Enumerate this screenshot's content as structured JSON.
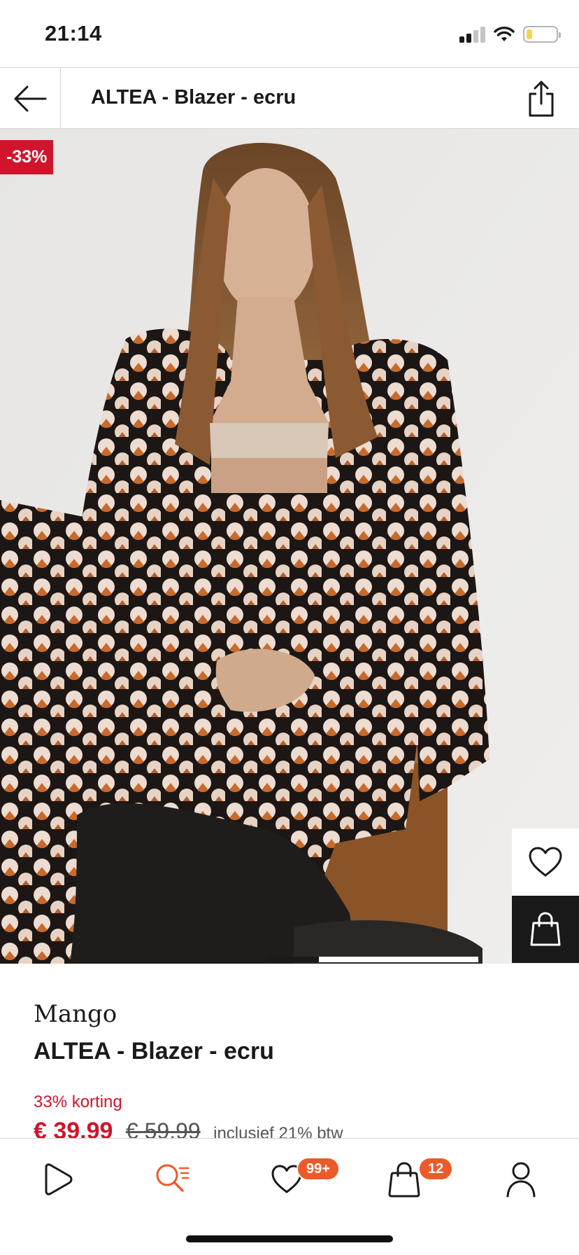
{
  "status_bar": {
    "time": "21:14",
    "icons": [
      "cellular-signal-icon",
      "wifi-icon",
      "battery-icon"
    ],
    "battery_level": 0.2
  },
  "header": {
    "title": "ALTEA - Blazer - ecru",
    "back_icon": "arrow-left-icon",
    "share_icon": "share-icon"
  },
  "hero": {
    "discount_badge": "-33%",
    "wishlist_icon": "heart-icon",
    "bag_icon": "shopping-bag-icon",
    "carousel": {
      "current": 1,
      "total": 4
    }
  },
  "product": {
    "brand": "Mango",
    "title": "ALTEA - Blazer - ecru",
    "discount_text": "33% korting",
    "price_current": "€ 39,99",
    "price_original": "€ 59,99",
    "vat_note": "inclusief 21% btw"
  },
  "tab_bar": {
    "tabs": [
      {
        "name": "home",
        "icon": "play-home-icon"
      },
      {
        "name": "search",
        "icon": "search-list-icon",
        "active": true
      },
      {
        "name": "wishlist",
        "icon": "heart-icon",
        "badge": "99+"
      },
      {
        "name": "bag",
        "icon": "shopping-bag-icon",
        "badge": "12"
      },
      {
        "name": "account",
        "icon": "user-icon"
      }
    ]
  },
  "colors": {
    "accent_orange": "#ec5a2a",
    "sale_red": "#d0142c",
    "text_dark": "#1a1a1a"
  }
}
